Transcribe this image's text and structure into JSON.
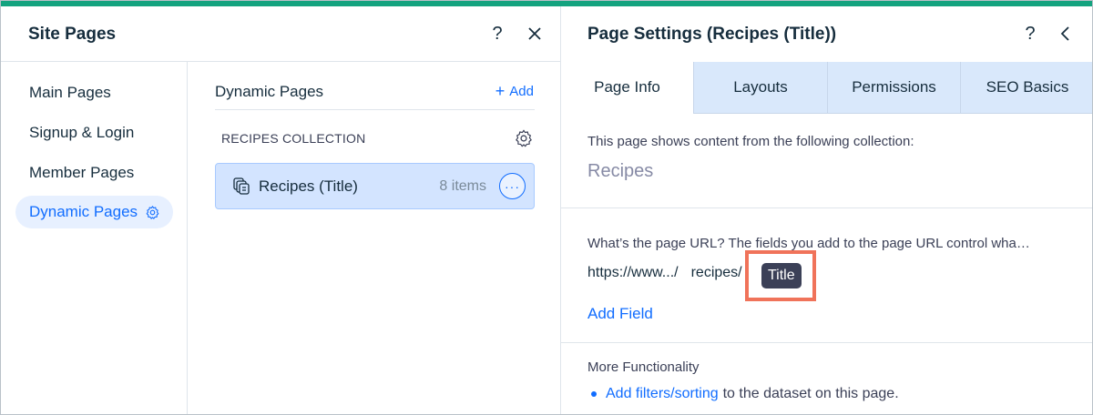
{
  "site_pages": {
    "title": "Site Pages",
    "help_label": "?",
    "sidebar": [
      {
        "label": "Main Pages"
      },
      {
        "label": "Signup & Login"
      },
      {
        "label": "Member Pages"
      },
      {
        "label": "Dynamic Pages",
        "active": true
      }
    ],
    "dynamic_pages": {
      "title": "Dynamic Pages",
      "add_label": "Add",
      "collection_label": "RECIPES COLLECTION",
      "items": [
        {
          "label": "Recipes (Title)",
          "count": "8 items",
          "more": "···"
        }
      ]
    }
  },
  "page_settings": {
    "title": "Page Settings (Recipes (Title))",
    "help_label": "?",
    "tabs": [
      {
        "label": "Page Info",
        "active": true
      },
      {
        "label": "Layouts"
      },
      {
        "label": "Permissions"
      },
      {
        "label": "SEO Basics"
      }
    ],
    "collection_intro": "This page shows content from the following collection:",
    "collection_name": "Recipes",
    "url_question": "What’s the page URL? The fields you add to the page URL control wha…",
    "url_base": "https://www.../",
    "url_segment": "recipes/",
    "url_field": "Title",
    "add_field": "Add Field",
    "more_title": "More Functionality",
    "bullet_link": "Add filters/sorting",
    "bullet_rest": "to the dataset on this page."
  },
  "colors": {
    "accent": "#116dff",
    "topbar": "#14a37f",
    "highlight_box": "#f0735a",
    "active_item_bg": "#d3e4ff"
  }
}
